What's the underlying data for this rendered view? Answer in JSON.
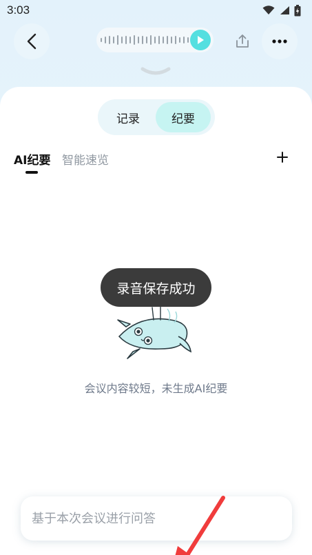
{
  "status_bar": {
    "time": "3:03"
  },
  "segment": {
    "tabs": [
      {
        "label": "记录",
        "active": false
      },
      {
        "label": "纪要",
        "active": true
      }
    ]
  },
  "subtabs": [
    {
      "label": "AI纪要",
      "active": true
    },
    {
      "label": "智能速览",
      "active": false
    }
  ],
  "empty_state": {
    "message": "会议内容较短，未生成AI纪要"
  },
  "toast": {
    "message": "录音保存成功"
  },
  "ask": {
    "placeholder": "基于本次会议进行问答",
    "value": ""
  },
  "colors": {
    "accent": "#55dfe0",
    "segment_active": "#c6f4f2",
    "annotation_arrow": "#f03c3c"
  },
  "icons": [
    "back-icon",
    "play-icon",
    "share-icon",
    "more-icon",
    "collapse-chevron-icon",
    "add-icon",
    "wifi-icon",
    "signal-icon",
    "battery-icon"
  ]
}
